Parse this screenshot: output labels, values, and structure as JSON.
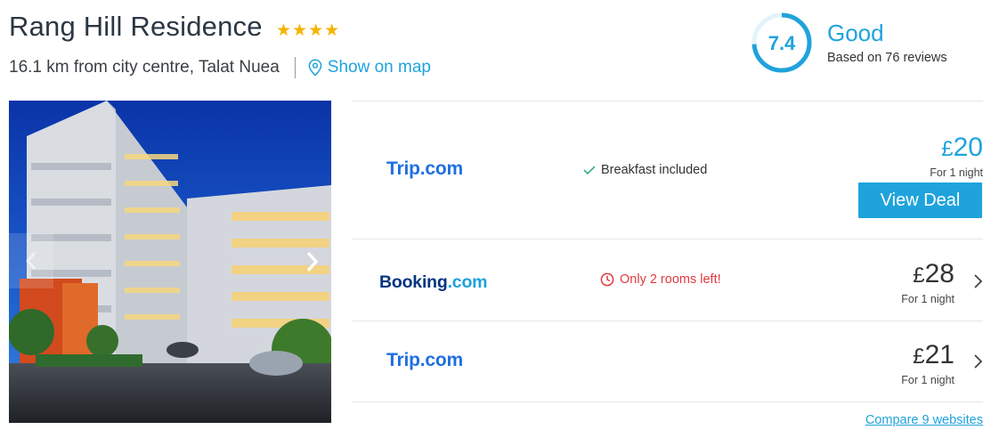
{
  "hotel": {
    "name": "Rang Hill Residence",
    "stars": 4,
    "distance_text": "16.1 km from city centre, Talat Nuea",
    "map_link_label": "Show on map"
  },
  "rating": {
    "score": "7.4",
    "score_fraction": 0.74,
    "label": "Good",
    "reviews_text": "Based on 76 reviews",
    "accent_color": "#1fa3dc"
  },
  "gallery": {
    "prev_icon": "chevron-left-icon",
    "next_icon": "chevron-right-icon"
  },
  "deals": [
    {
      "provider_main": "Trip",
      "provider_suffix": ".com",
      "perk_icon": "checkmark-icon",
      "perk_text": "Breakfast included",
      "currency": "£",
      "price": "20",
      "per_text": "For 1 night",
      "cta_label": "View Deal"
    },
    {
      "provider_main": "Booking",
      "provider_suffix": ".com",
      "perk_icon": "clock-icon",
      "perk_text": "Only 2 rooms left!",
      "currency": "£",
      "price": "28",
      "per_text": "For 1 night"
    },
    {
      "provider_main": "Trip",
      "provider_suffix": ".com",
      "currency": "£",
      "price": "21",
      "per_text": "For 1 night"
    }
  ],
  "compare_link_label": "Compare 9 websites",
  "colors": {
    "accent": "#1fa3dc",
    "star": "#f5b400",
    "scarcity": "#e0393e",
    "trip_brand": "#1f6fe0",
    "booking_brand": "#003580"
  }
}
